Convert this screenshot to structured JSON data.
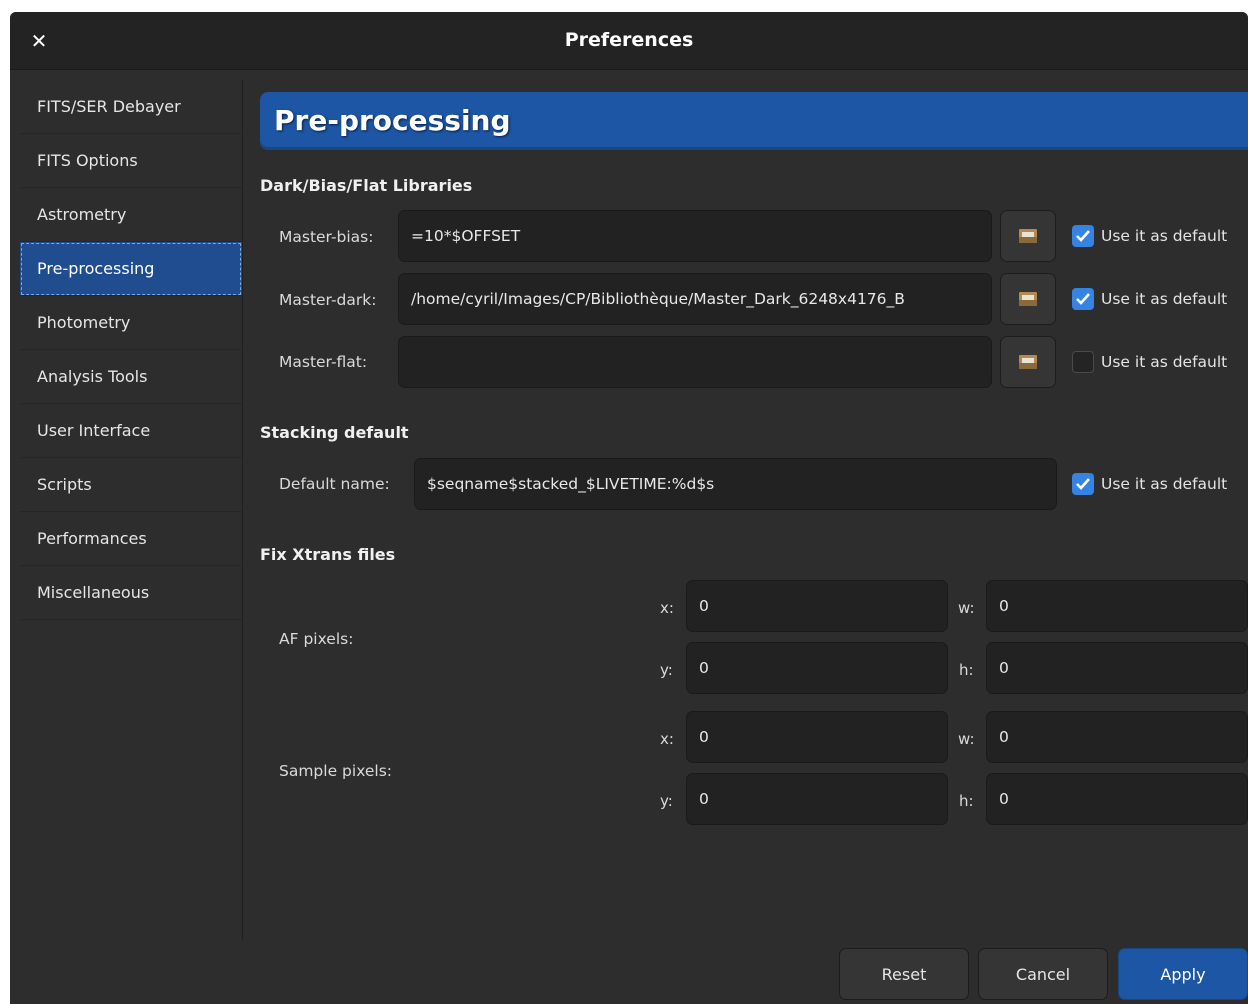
{
  "window": {
    "title": "Preferences",
    "close_glyph": "✕"
  },
  "sidebar": {
    "items": [
      {
        "label": "FITS/SER Debayer"
      },
      {
        "label": "FITS Options"
      },
      {
        "label": "Astrometry"
      },
      {
        "label": "Pre-processing"
      },
      {
        "label": "Photometry"
      },
      {
        "label": "Analysis Tools"
      },
      {
        "label": "User Interface"
      },
      {
        "label": "Scripts"
      },
      {
        "label": "Performances"
      },
      {
        "label": "Miscellaneous"
      }
    ],
    "active_item": "Pre-processing"
  },
  "page": {
    "heading": "Pre-processing",
    "libraries": {
      "title": "Dark/Bias/Flat Libraries",
      "bias": {
        "label": "Master-bias:",
        "value": "=10*$OFFSET",
        "default_label": "Use it as default",
        "default_checked": true
      },
      "dark": {
        "label": "Master-dark:",
        "value": "/home/cyril/Images/CP/Bibliothèque/Master_Dark_6248x4176_B",
        "default_label": "Use it as default",
        "default_checked": true
      },
      "flat": {
        "label": "Master-flat:",
        "value": "",
        "default_label": "Use it as default",
        "default_checked": false
      }
    },
    "stacking": {
      "title": "Stacking default",
      "label": "Default name:",
      "value": "$seqname$stacked_$LIVETIME:%d$s",
      "default_label": "Use it as default",
      "default_checked": true
    },
    "xtrans": {
      "title": "Fix Xtrans files",
      "af": {
        "label": "AF pixels:",
        "x_label": "x:",
        "x": "0",
        "w_label": "w:",
        "w": "0",
        "y_label": "y:",
        "y": "0",
        "h_label": "h:",
        "h": "0"
      },
      "sample": {
        "label": "Sample pixels:",
        "x_label": "x:",
        "x": "0",
        "w_label": "w:",
        "w": "0",
        "y_label": "y:",
        "y": "0",
        "h_label": "h:",
        "h": "0"
      }
    }
  },
  "footer": {
    "reset": "Reset",
    "cancel": "Cancel",
    "apply": "Apply"
  },
  "colors": {
    "accent": "#1d56a5",
    "checkbox": "#3584e4",
    "background": "#2d2d2d"
  }
}
